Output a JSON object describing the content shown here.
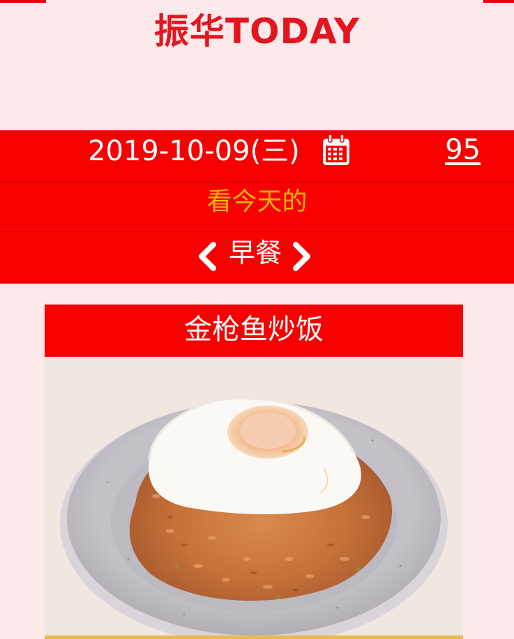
{
  "header": {
    "title": "振华TODAY"
  },
  "date_bar": {
    "date_text": "2019-10-09(三)",
    "calendar_icon": "calendar-icon",
    "count": "95"
  },
  "prompt": {
    "text": "看今天的"
  },
  "meal_selector": {
    "prev_icon": "chevron-left-icon",
    "label": "早餐",
    "next_icon": "chevron-right-icon"
  },
  "dish": {
    "name": "金枪鱼炒饭"
  },
  "colors": {
    "background": "#fde8ea",
    "brand_red": "#f60000",
    "title_red": "#e3161f",
    "prompt_yellow": "#ffb400",
    "card_strip": "#e9b94a"
  }
}
